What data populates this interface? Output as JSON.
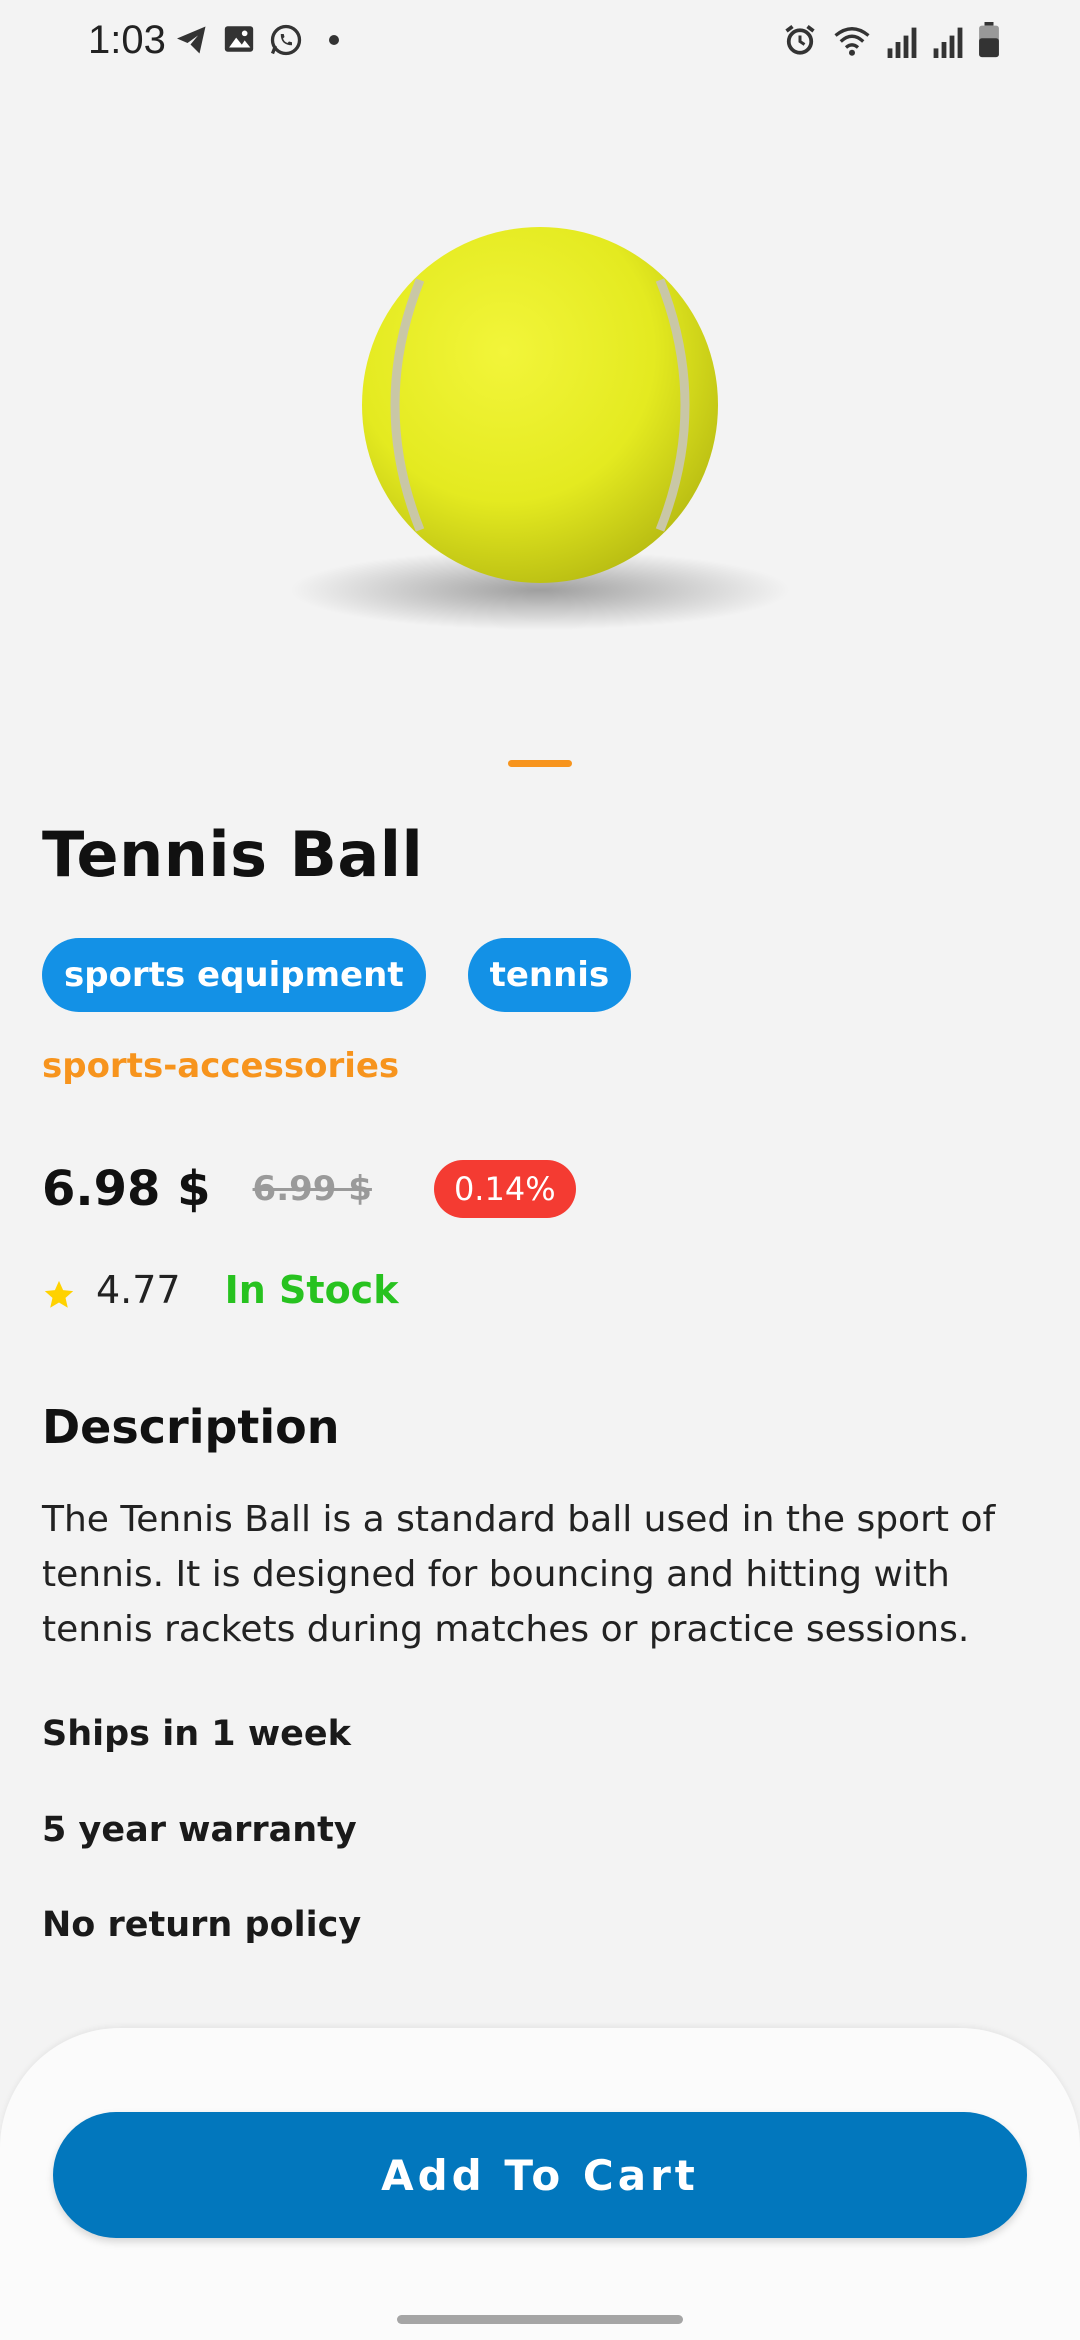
{
  "status_bar": {
    "time": "1:03",
    "left_icons": [
      "telegram-icon",
      "gallery-icon",
      "whatsapp-icon",
      "dot-icon"
    ],
    "right_icons": [
      "alarm-icon",
      "wifi-icon",
      "signal-icon",
      "signal-icon",
      "battery-icon"
    ]
  },
  "product": {
    "image_icon": "tennis-ball",
    "title": "Tennis Ball",
    "tags": [
      "sports equipment",
      "tennis"
    ],
    "category": "sports-accessories",
    "price": "6.98 $",
    "old_price": "6.99 $",
    "discount": "0.14%",
    "rating": "4.77",
    "stock": "In Stock"
  },
  "description": {
    "heading": "Description",
    "text": "The Tennis Ball is a standard ball used in the sport of tennis. It is designed for bouncing and hitting with tennis rackets during matches or practice sessions.",
    "shipping": "Ships in 1 week",
    "warranty": "5 year warranty",
    "returns": "No return policy"
  },
  "actions": {
    "add_to_cart": "Add To Cart"
  },
  "colors": {
    "accent_orange": "#f7941d",
    "tag_blue": "#1391e6",
    "button_blue": "#0277bd",
    "discount_red": "#f43b32",
    "stock_green": "#27c21f",
    "star_yellow": "#ffd200"
  }
}
